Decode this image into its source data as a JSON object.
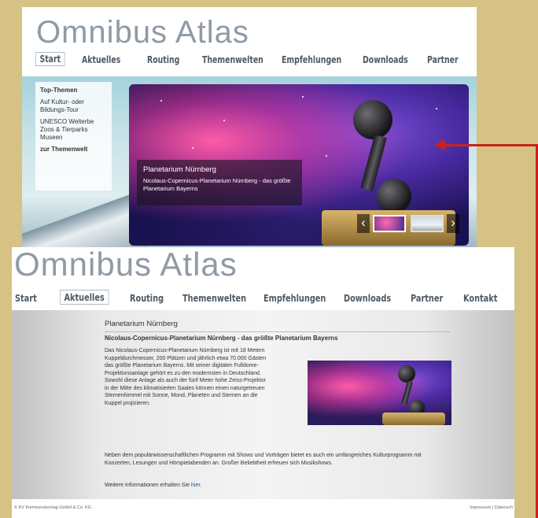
{
  "brand": "Omnibus Atlas",
  "top": {
    "nav": [
      "Start",
      "Aktuelles",
      "Routing",
      "Themenwelten",
      "Empfehlungen",
      "Downloads",
      "Partner"
    ],
    "active": "Start",
    "topics": {
      "heading": "Top-Themen",
      "items": [
        "Auf Kultur- oder Bildungs-Tour",
        "UNESCO Welterbe",
        "Zoos & Tierparks",
        "Museen"
      ],
      "link": "zur Themenwelt"
    },
    "slide": {
      "title": "Planetarium Nürnberg",
      "desc": "Nicolaus-Copernicus-Planetarium Nürnberg - das größte Planetarium Bayerns"
    },
    "prev_icon": "‹",
    "next_icon": "›"
  },
  "bottom": {
    "nav": [
      "Start",
      "Aktuelles",
      "Routing",
      "Themenwelten",
      "Empfehlungen",
      "Downloads",
      "Partner",
      "Kontakt"
    ],
    "active": "Aktuelles",
    "title": "Planetarium Nürnberg",
    "subtitle": "Nicolaus-Copernicus-Planetarium Nürnberg - das größte Planetarium Bayerns",
    "para1": "Das Nicolaus-Copernicus-Planetarium Nürnberg ist mit 18 Metern Kuppeldurchmesser, 200 Plätzen und jährlich etwa 70.000 Gästen das größte Planetarium Bayerns. Mit seiner digitalen Fulldome-Projektionsanlage gehört es zu den modernsten in Deutschland. Sowohl diese Anlage als auch der fünf Meter hohe Zeiss-Projektor in der Mitte des klimatisierten Saales können einen naturgetreuen Sternenhimmel mit Sonne, Mond, Planeten und Sternen an die Kuppel projizieren.",
    "para2": "Neben dem populärwissenschaftlichen Programm mit Shows und Vorträgen bietet es auch ein umfangreiches Kulturprogramm mit Konzerten, Lesungen und Hörspielabenden an. Großer Beliebtheit erfreuen sich Musikshows.",
    "more_text": "Weitere Informationen erhalten Sie ",
    "more_link": "hier",
    "more_end": ".",
    "footer_left": "© KV Kommunalverlag GmbH & Co. KG",
    "footer_right": "Impressum | Datensch"
  },
  "colors": {
    "arrow": "#c8221c",
    "background": "#d5c284"
  }
}
